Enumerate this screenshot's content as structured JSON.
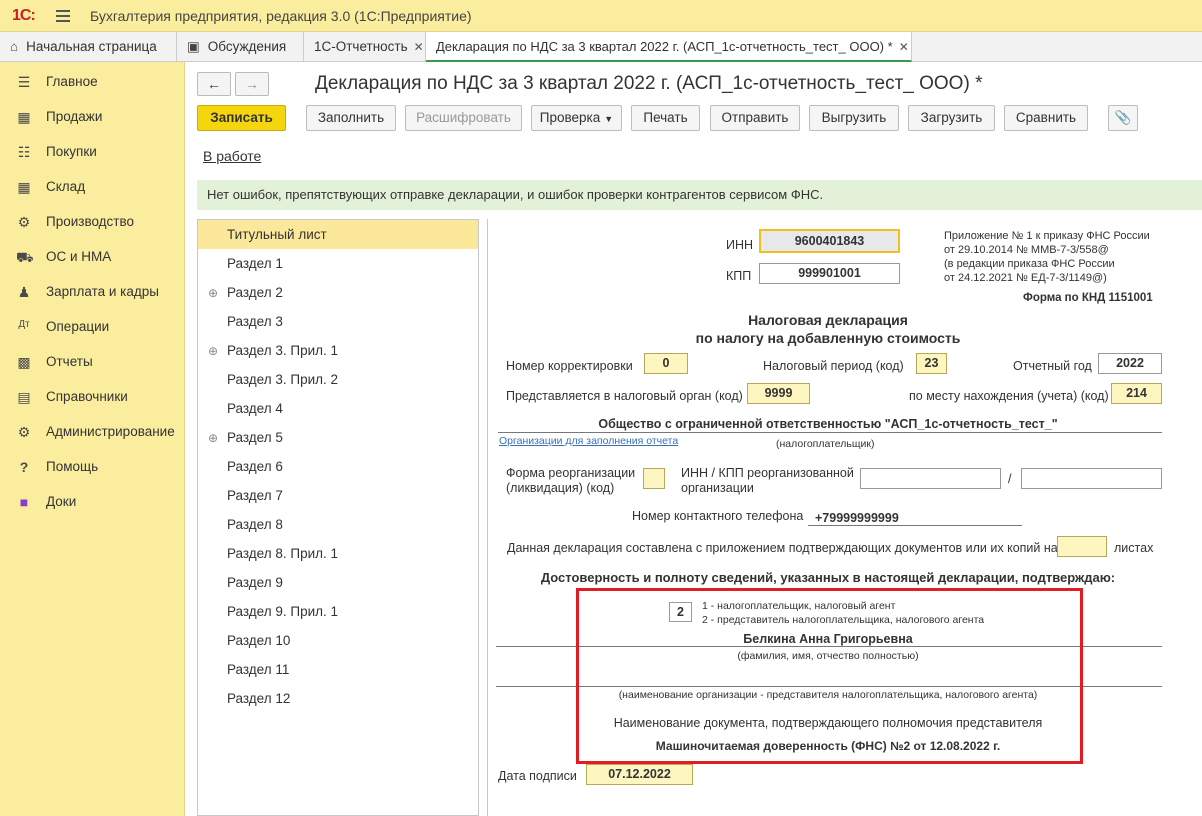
{
  "app": {
    "logo": "1С:",
    "title": "Бухгалтерия предприятия, редакция 3.0  (1С:Предприятие)"
  },
  "tabs": [
    {
      "label": "Начальная страница"
    },
    {
      "label": "Обсуждения"
    },
    {
      "label": "1С-Отчетность",
      "close": "✕"
    },
    {
      "label": "Декларация по НДС за 3 квартал 2022 г. (АСП_1с-отчетность_тест_ ООО) *",
      "close": "✕"
    }
  ],
  "sidebar": {
    "items": [
      {
        "label": "Главное",
        "icon": "menu-lines-icon"
      },
      {
        "label": "Продажи",
        "icon": "bag-icon"
      },
      {
        "label": "Покупки",
        "icon": "cart-icon"
      },
      {
        "label": "Склад",
        "icon": "warehouse-icon"
      },
      {
        "label": "Производство",
        "icon": "factory-icon"
      },
      {
        "label": "ОС и НМА",
        "icon": "truck-icon"
      },
      {
        "label": "Зарплата и кадры",
        "icon": "person-icon"
      },
      {
        "label": "Операции",
        "icon": "operations-icon"
      },
      {
        "label": "Отчеты",
        "icon": "bar-chart-icon"
      },
      {
        "label": "Справочники",
        "icon": "book-icon"
      },
      {
        "label": "Администрирование",
        "icon": "gear-icon"
      },
      {
        "label": "Помощь",
        "icon": "question-icon"
      },
      {
        "label": "Доки",
        "icon": "folder-icon"
      }
    ]
  },
  "doc": {
    "title": "Декларация по НДС за 3 квартал 2022 г. (АСП_1с-отчетность_тест_ ООО) *",
    "status": "В работе",
    "notice": "Нет ошибок, препятствующих отправке декларации, и ошибок проверки контрагентов сервисом ФНС."
  },
  "toolbar": {
    "save": "Записать",
    "fill": "Заполнить",
    "decode": "Расшифровать",
    "check": "Проверка",
    "print": "Печать",
    "send": "Отправить",
    "export": "Выгрузить",
    "import": "Загрузить",
    "compare": "Сравнить"
  },
  "tree": {
    "items": [
      {
        "label": "Титульный лист",
        "selected": true,
        "expandable": false
      },
      {
        "label": "Раздел 1",
        "expandable": false
      },
      {
        "label": "Раздел 2",
        "expandable": true
      },
      {
        "label": "Раздел 3",
        "expandable": false
      },
      {
        "label": "Раздел 3. Прил. 1",
        "expandable": true
      },
      {
        "label": "Раздел 3. Прил. 2",
        "expandable": false
      },
      {
        "label": "Раздел 4",
        "expandable": false
      },
      {
        "label": "Раздел 5",
        "expandable": true
      },
      {
        "label": "Раздел 6",
        "expandable": false
      },
      {
        "label": "Раздел 7",
        "expandable": false
      },
      {
        "label": "Раздел 8",
        "expandable": false
      },
      {
        "label": "Раздел 8. Прил. 1",
        "expandable": false
      },
      {
        "label": "Раздел 9",
        "expandable": false
      },
      {
        "label": "Раздел 9. Прил. 1",
        "expandable": false
      },
      {
        "label": "Раздел 10",
        "expandable": false
      },
      {
        "label": "Раздел 11",
        "expandable": false
      },
      {
        "label": "Раздел 12",
        "expandable": false
      }
    ]
  },
  "form": {
    "inn_label": "ИНН",
    "inn": "9600401843",
    "kpp_label": "КПП",
    "kpp": "999901001",
    "appendix": [
      "Приложение № 1 к приказу ФНС России",
      "от 29.10.2014 № ММВ-7-3/558@",
      "(в редакции приказа ФНС России",
      "от 24.12.2021 № ЕД-7-3/1149@)"
    ],
    "knd": "Форма по КНД 1151001",
    "heading1": "Налоговая декларация",
    "heading2": "по налогу на добавленную стоимость",
    "corr_label": "Номер корректировки",
    "corr": "0",
    "period_label": "Налоговый период (код)",
    "period": "23",
    "year_label": "Отчетный год",
    "year": "2022",
    "organ_label": "Представляется в налоговый орган (код)",
    "organ": "9999",
    "place_label": "по месту нахождения (учета) (код)",
    "place": "214",
    "org_name": "Общество с ограниченной ответственностью \"АСП_1с-отчетность_тест_\"",
    "org_link": "Организации для заполнения отчета",
    "taxpayer_caption": "(налогоплательщик)",
    "reorg_label1": "Форма реорганизации",
    "reorg_label2": "(ликвидация) (код)",
    "reorg_inn_label1": "ИНН / КПП реорганизованной",
    "reorg_inn_label2": "организации",
    "slash": "/",
    "phone_label": "Номер контактного телефона",
    "phone": "+79999999999",
    "pages_label": "Данная декларация составлена с приложением подтверждающих документов или их копий на",
    "pages_suffix": "листах",
    "confirm": "Достоверность и полноту сведений, указанных в настоящей декларации, подтверждаю:",
    "signer_code": "2",
    "signer_opt1": "1 - налогоплательщик, налоговый агент",
    "signer_opt2": "2 - представитель налогоплательщика, налогового агента",
    "signer_name": "Белкина Анна  Григорьевна",
    "signer_caption": "(фамилия, имя, отчество полностью)",
    "rep_org_caption": "(наименование организации - представителя налогоплательщика, налогового агента)",
    "doc_label": "Наименование документа, подтверждающего полномочия представителя",
    "doc_value": "Машиночитаемая доверенность (ФНС) №2 от 12.08.2022 г.",
    "date_label": "Дата подписи",
    "date": "07.12.2022"
  },
  "colors": {
    "accent": "#fbed9e",
    "highlight": "#e01c24",
    "notice_bg": "#e3f1d9"
  }
}
